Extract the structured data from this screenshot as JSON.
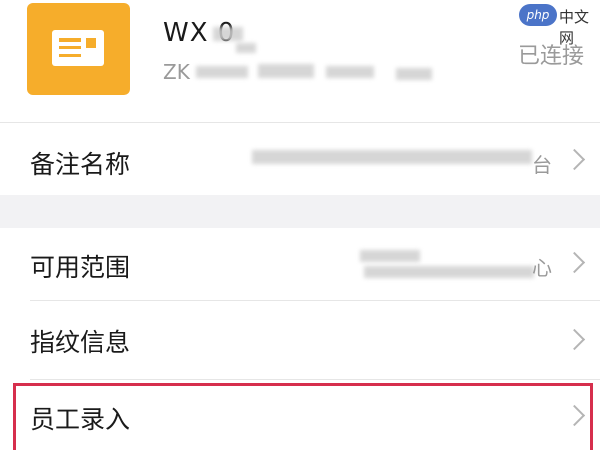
{
  "device": {
    "name": "WX     0",
    "subtitle": "ZK",
    "status": "已连接"
  },
  "rows": [
    {
      "label": "备注名称",
      "value": "台"
    },
    {
      "label": "可用范围",
      "value": "心"
    },
    {
      "label": "指纹信息",
      "value": ""
    },
    {
      "label": "员工录入",
      "value": ""
    }
  ],
  "watermark": {
    "php": "php",
    "text": "中文网"
  },
  "colors": {
    "icon_bg": "#f6ad2b",
    "highlight": "#d62f4d",
    "secondary_text": "#9a9a9a"
  },
  "icons": {
    "device": "card-icon",
    "row_arrow": "chevron-right-icon"
  }
}
